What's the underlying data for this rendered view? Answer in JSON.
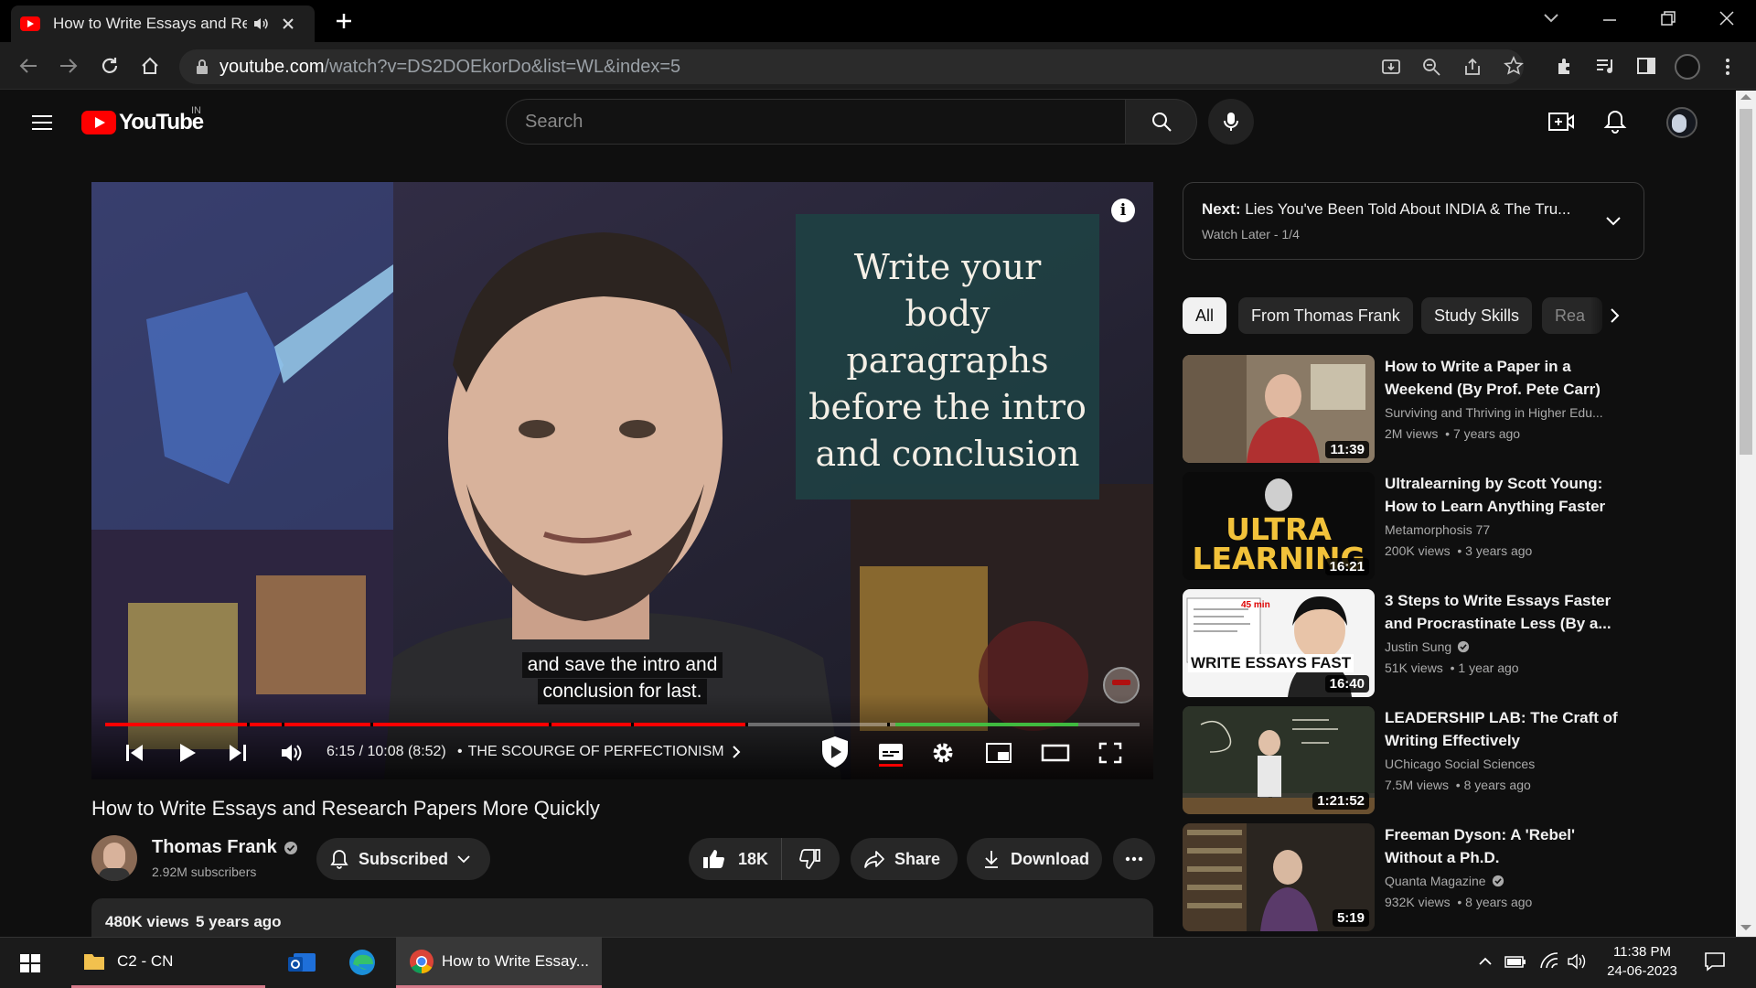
{
  "browser": {
    "tab_title": "How to Write Essays and Research Papers More Quickly",
    "url_host": "youtube.com",
    "url_path": "/watch?v=DS2DOEkorDo&list=WL&index=5"
  },
  "youtube": {
    "logo_text": "YouTube",
    "region": "IN",
    "search_placeholder": "Search"
  },
  "video": {
    "overlay_text": [
      "Write your",
      "body",
      "paragraphs",
      "before the intro",
      "and conclusion"
    ],
    "captions": [
      "and save the intro and",
      "conclusion for last."
    ],
    "time": "6:15 / 10:08 (8:52)",
    "chapter": "THE SCOURGE OF PERFECTIONISM",
    "progress_fraction": 0.62,
    "title": "How to Write Essays and Research Papers More Quickly"
  },
  "channel": {
    "name": "Thomas Frank",
    "subscribers": "2.92M subscribers",
    "subscribe_label": "Subscribed"
  },
  "actions": {
    "likes": "18K",
    "share": "Share",
    "download": "Download"
  },
  "description": {
    "views": "480K views",
    "age": "5 years ago"
  },
  "playlist": {
    "next_label": "Next:",
    "next_title": "Lies You've Been Told About INDIA & The Tru...",
    "playlist_info": "Watch Later - 1/4"
  },
  "chips": [
    "All",
    "From Thomas Frank",
    "Study Skills",
    "Rea"
  ],
  "recommendations": [
    {
      "title": "How to Write a Paper in a Weekend (By Prof. Pete Carr)",
      "channel": "Surviving and Thriving in Higher Edu...",
      "views": "2M views",
      "age": "7 years ago",
      "duration": "11:39",
      "verified": false
    },
    {
      "title": "Ultralearning by Scott Young: How to Learn Anything Faster",
      "channel": "Metamorphosis 77",
      "views": "200K views",
      "age": "3 years ago",
      "duration": "16:21",
      "verified": false,
      "thumb_text": [
        "ULTRA",
        "LEARNING"
      ]
    },
    {
      "title": "3 Steps to Write Essays Faster and Procrastinate Less (By a...",
      "channel": "Justin Sung",
      "views": "51K views",
      "age": "1 year ago",
      "duration": "16:40",
      "verified": true,
      "thumb_text": [
        "WRITE ESSAYS FAST"
      ],
      "thumb_badge": "45 min"
    },
    {
      "title": "LEADERSHIP LAB: The Craft of Writing Effectively",
      "channel": "UChicago Social Sciences",
      "views": "7.5M views",
      "age": "8 years ago",
      "duration": "1:21:52",
      "verified": false
    },
    {
      "title": "Freeman Dyson: A 'Rebel' Without a Ph.D.",
      "channel": "Quanta Magazine",
      "views": "932K views",
      "age": "8 years ago",
      "duration": "5:19",
      "verified": true
    }
  ],
  "taskbar": {
    "folder_label": "C2 - CN",
    "chrome_label": "How to Write Essay...",
    "time": "11:38 PM",
    "date": "24-06-2023"
  }
}
